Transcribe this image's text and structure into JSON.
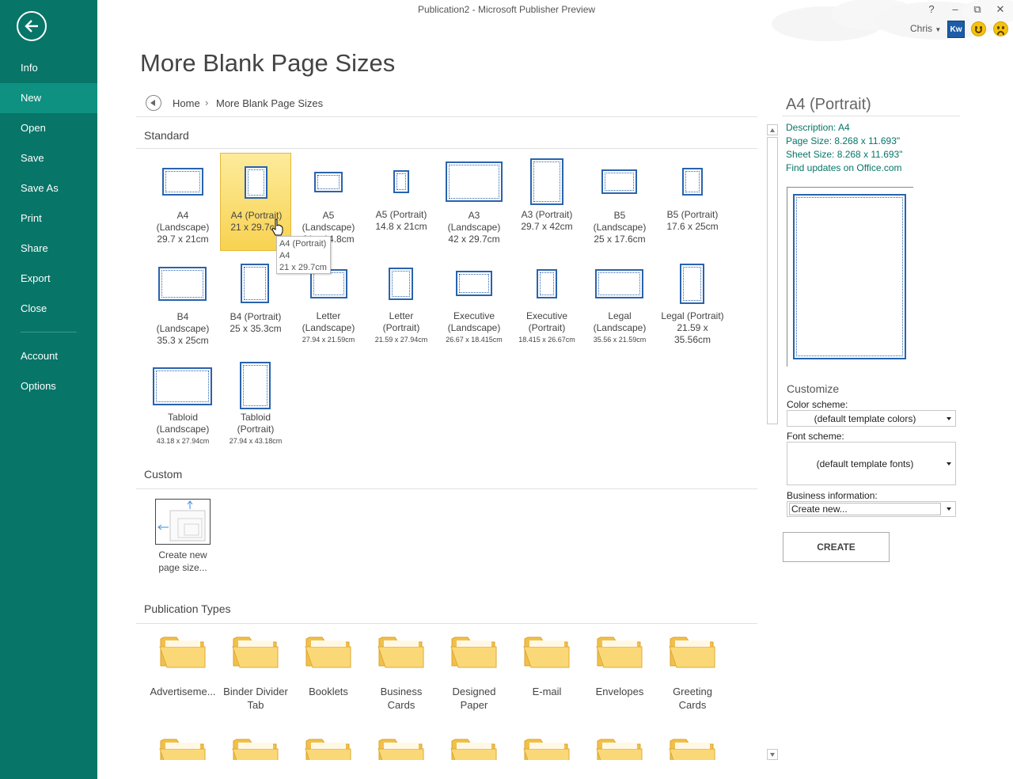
{
  "window": {
    "title": "Publication2 - Microsoft Publisher Preview",
    "user": "Chris",
    "avatar_text": "Kw",
    "controls": {
      "help": "?",
      "minimize": "–",
      "restore": "⧉",
      "close": "✕"
    }
  },
  "sidebar": {
    "back_icon": "back-arrow-icon",
    "items": [
      {
        "label": "Info"
      },
      {
        "label": "New",
        "active": true
      },
      {
        "label": "Open"
      },
      {
        "label": "Save"
      },
      {
        "label": "Save As"
      },
      {
        "label": "Print"
      },
      {
        "label": "Share"
      },
      {
        "label": "Export"
      },
      {
        "label": "Close"
      },
      {
        "label": "Account"
      },
      {
        "label": "Options"
      }
    ],
    "accent": "#077568"
  },
  "page_title": "More Blank Page Sizes",
  "breadcrumb": {
    "home": "Home",
    "separator": "›",
    "current": "More Blank Page Sizes"
  },
  "sections": {
    "standard": "Standard",
    "custom": "Custom",
    "publication_types": "Publication Types"
  },
  "standard_sizes": [
    {
      "line1": "A4",
      "line2": "(Landscape)",
      "dim": "29.7 x 21cm"
    },
    {
      "line1": "A4 (Portrait)",
      "line2": "",
      "dim": "21 x 29.7cm",
      "selected": true
    },
    {
      "line1": "A5",
      "line2": "(Landscape)",
      "dim": "21 x 14.8cm"
    },
    {
      "line1": "A5 (Portrait)",
      "line2": "",
      "dim": "14.8 x 21cm"
    },
    {
      "line1": "A3",
      "line2": "(Landscape)",
      "dim": "42 x 29.7cm"
    },
    {
      "line1": "A3 (Portrait)",
      "line2": "",
      "dim": "29.7 x 42cm"
    },
    {
      "line1": "B5",
      "line2": "(Landscape)",
      "dim": "25 x 17.6cm"
    },
    {
      "line1": "B5 (Portrait)",
      "line2": "",
      "dim": "17.6 x 25cm"
    },
    {
      "line1": "B4",
      "line2": "(Landscape)",
      "dim": "35.3 x 25cm"
    },
    {
      "line1": "B4 (Portrait)",
      "line2": "",
      "dim": "25 x 35.3cm"
    },
    {
      "line1": "Letter",
      "line2": "(Landscape)",
      "dim": "27.94 x 21.59cm"
    },
    {
      "line1": "Letter",
      "line2": "(Portrait)",
      "dim": "21.59 x 27.94cm"
    },
    {
      "line1": "Executive",
      "line2": "(Landscape)",
      "dim": "26.67 x 18.415cm"
    },
    {
      "line1": "Executive",
      "line2": "(Portrait)",
      "dim": "18.415 x 26.67cm"
    },
    {
      "line1": "Legal",
      "line2": "(Landscape)",
      "dim": "35.56 x 21.59cm"
    },
    {
      "line1": "Legal (Portrait)",
      "line2": "21.59 x",
      "dim": "35.56cm"
    },
    {
      "line1": "Tabloid",
      "line2": "(Landscape)",
      "dim": "43.18 x 27.94cm"
    },
    {
      "line1": "Tabloid",
      "line2": "(Portrait)",
      "dim": "27.94 x 43.18cm"
    }
  ],
  "tooltip": {
    "line1": "A4 (Portrait)",
    "line2": "A4",
    "line3": "21 x 29.7cm"
  },
  "custom": {
    "line1": "Create new",
    "line2": "page size..."
  },
  "publication_types": [
    {
      "line1": "Advertiseme...",
      "line2": ""
    },
    {
      "line1": "Binder Divider",
      "line2": "Tab"
    },
    {
      "line1": "Booklets",
      "line2": ""
    },
    {
      "line1": "Business",
      "line2": "Cards"
    },
    {
      "line1": "Designed",
      "line2": "Paper"
    },
    {
      "line1": "E-mail",
      "line2": ""
    },
    {
      "line1": "Envelopes",
      "line2": ""
    },
    {
      "line1": "Greeting",
      "line2": "Cards"
    }
  ],
  "detail": {
    "title": "A4 (Portrait)",
    "description": "Description: A4",
    "page_size": "Page Size: 8.268 x 11.693\"",
    "sheet_size": "Sheet Size: 8.268 x 11.693\"",
    "link": "Find updates on Office.com",
    "customize": "Customize",
    "color_scheme_label": "Color scheme:",
    "color_scheme_value": "(default template colors)",
    "font_scheme_label": "Font scheme:",
    "font_scheme_value": "(default template fonts)",
    "business_label": "Business information:",
    "business_value": "Create new...",
    "create": "CREATE"
  }
}
